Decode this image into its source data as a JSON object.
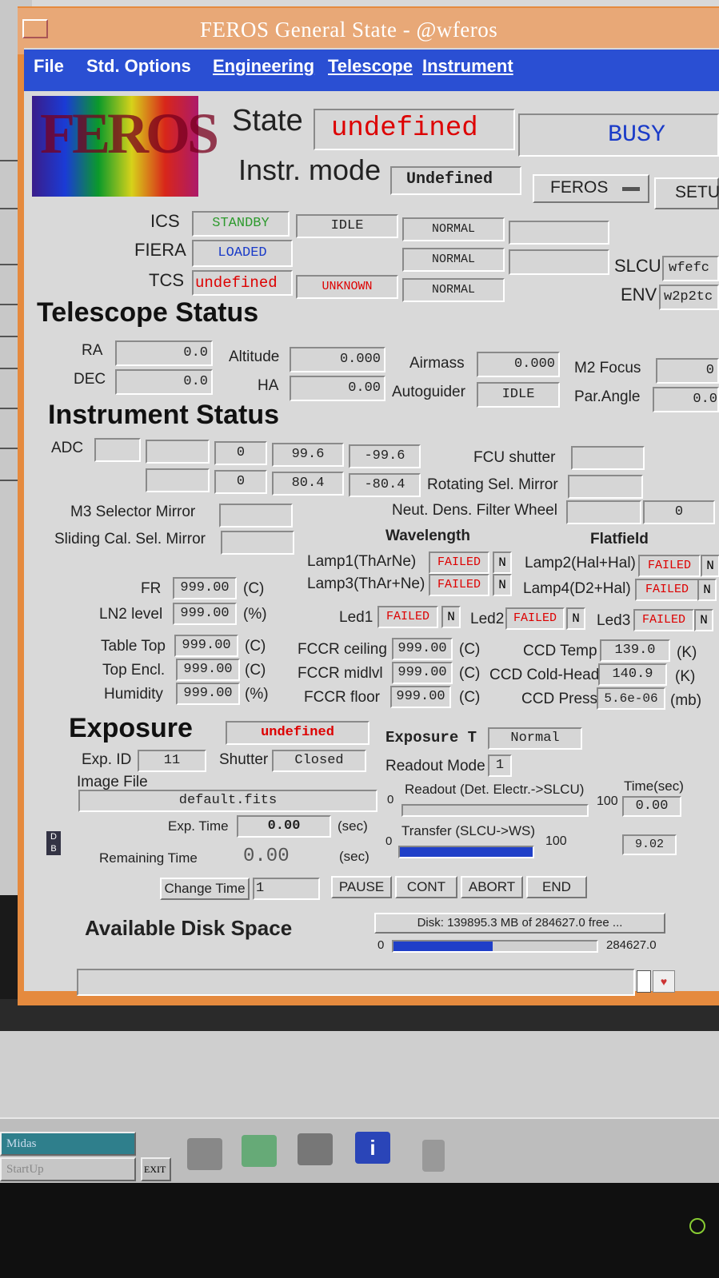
{
  "window": {
    "title": "FEROS General State - @wferos"
  },
  "menu": [
    "File",
    "Std. Options",
    "Engineering",
    "Telescope",
    "Instrument"
  ],
  "logo": {
    "text": "FEROS"
  },
  "header": {
    "state_label": "State",
    "state_value": "undefined",
    "busy": "BUSY",
    "mode_label": "Instr. mode",
    "mode_value": "Undefined",
    "feros_option": "FEROS",
    "setup_button": "SETU"
  },
  "subsystems": {
    "ics": {
      "label": "ICS",
      "v1": "STANDBY",
      "v2": "IDLE",
      "v3": "NORMAL",
      "v4": ""
    },
    "fiera": {
      "label": "FIERA",
      "v1": "LOADED",
      "v3": "NORMAL",
      "v4": ""
    },
    "tcs": {
      "label": "TCS",
      "v1": "undefined",
      "v2": "UNKNOWN",
      "v3": "NORMAL"
    },
    "slcu_label": "SLCU",
    "slcu_value": "wfefc",
    "env_label": "ENV",
    "env_value": "w2p2tc"
  },
  "telescope": {
    "heading": "Telescope Status",
    "ra_label": "RA",
    "ra": "0.0",
    "dec_label": "DEC",
    "dec": "0.0",
    "alt_label": "Altitude",
    "alt": "0.000",
    "ha_label": "HA",
    "ha": "0.00",
    "airmass_label": "Airmass",
    "airmass": "0.000",
    "autoguider_label": "Autoguider",
    "autoguider": "IDLE",
    "m2_label": "M2 Focus",
    "m2": "0",
    "parangle_label": "Par.Angle",
    "parangle": "0.0"
  },
  "instrument": {
    "heading": "Instrument Status",
    "adc_label": "ADC",
    "adc_row1": [
      "",
      "",
      "0",
      "99.6",
      "-99.6"
    ],
    "adc_row2": [
      "",
      "0",
      "80.4",
      "-80.4"
    ],
    "fcu_label": "FCU shutter",
    "rot_label": "Rotating Sel. Mirror",
    "m3_label": "M3 Selector Mirror",
    "ndf_label": "Neut. Dens. Filter Wheel",
    "ndf_value": "0",
    "slide_label": "Sliding Cal. Sel. Mirror",
    "wavelength_label": "Wavelength",
    "flatfield_label": "Flatfield",
    "lamp1_label": "Lamp1(ThArNe)",
    "lamp1": "FAILED",
    "lamp1_n": "N",
    "lamp2_label": "Lamp2(Hal+Hal)",
    "lamp2": "FAILED",
    "lamp2_n": "N",
    "lamp3_label": "Lamp3(ThAr+Ne)",
    "lamp3": "FAILED",
    "lamp3_n": "N",
    "lamp4_label": "Lamp4(D2+Hal)",
    "lamp4": "FAILED",
    "lamp4_n": "N",
    "fr_label": "FR",
    "fr": "999.00",
    "fr_unit": "(C)",
    "ln2_label": "LN2 level",
    "ln2": "999.00",
    "ln2_unit": "(%)",
    "led1_label": "Led1",
    "led1": "FAILED",
    "led1_n": "N",
    "led2_label": "Led2",
    "led2": "FAILED",
    "led2_n": "N",
    "led3_label": "Led3",
    "led3": "FAILED",
    "led3_n": "N",
    "tabletop_label": "Table Top",
    "tabletop": "999.00",
    "tabletop_unit": "(C)",
    "topencl_label": "Top Encl.",
    "topencl": "999.00",
    "topencl_unit": "(C)",
    "humidity_label": "Humidity",
    "humidity": "999.00",
    "humidity_unit": "(%)",
    "fccr_ceil_label": "FCCR ceiling",
    "fccr_ceil": "999.00",
    "fccr_ceil_unit": "(C)",
    "fccr_mid_label": "FCCR midlvl",
    "fccr_mid": "999.00",
    "fccr_mid_unit": "(C)",
    "fccr_floor_label": "FCCR floor",
    "fccr_floor": "999.00",
    "fccr_floor_unit": "(C)",
    "ccd_temp_label": "CCD Temp",
    "ccd_temp": "139.0",
    "ccd_temp_unit": "(K)",
    "ccd_cold_label": "CCD Cold-Head",
    "ccd_cold": "140.9",
    "ccd_cold_unit": "(K)",
    "ccd_press_label": "CCD Press",
    "ccd_press": "5.6e-06",
    "ccd_press_unit": "(mb)"
  },
  "exposure": {
    "heading": "Exposure",
    "state": "undefined",
    "type_label": "Exposure T",
    "type": "Normal",
    "id_label": "Exp. ID",
    "id": "11",
    "shutter_label": "Shutter",
    "shutter": "Closed",
    "readout_mode_label": "Readout Mode",
    "readout_mode": "1",
    "image_label": "Image File",
    "image": "default.fits",
    "time_label": "Exp. Time",
    "time": "0.00",
    "time_unit": "(sec)",
    "remaining_label": "Remaining Time",
    "remaining": "0.00",
    "remaining_unit": "(sec)",
    "readout_label": "Readout (Det. Electr.->SLCU)",
    "readout_min": "0",
    "readout_max": "100",
    "readout_fraction": 0.0,
    "timesec_label": "Time(sec)",
    "readout_time": "0.00",
    "transfer_label": "Transfer (SLCU->WS)",
    "transfer_min": "0",
    "transfer_max": "100",
    "transfer_fraction": 1.0,
    "transfer_time": "9.02",
    "change_time": "Change Time",
    "change_value": "1",
    "pause": "PAUSE",
    "cont": "CONT",
    "abort": "ABORT",
    "end": "END"
  },
  "disk": {
    "heading": "Available Disk Space",
    "text": "Disk: 139895.3 MB of 284627.0 free ...",
    "min": "0",
    "max": "284627.0",
    "used_fraction": 0.49
  },
  "taskbar": {
    "midas": "Midas",
    "startup": "StartUp",
    "exit": "EXIT"
  },
  "colors": {
    "menubar": "#2a4fd3",
    "window_frame": "#e58a3e",
    "alert": "#d00000",
    "progress": "#1f3fc8"
  }
}
